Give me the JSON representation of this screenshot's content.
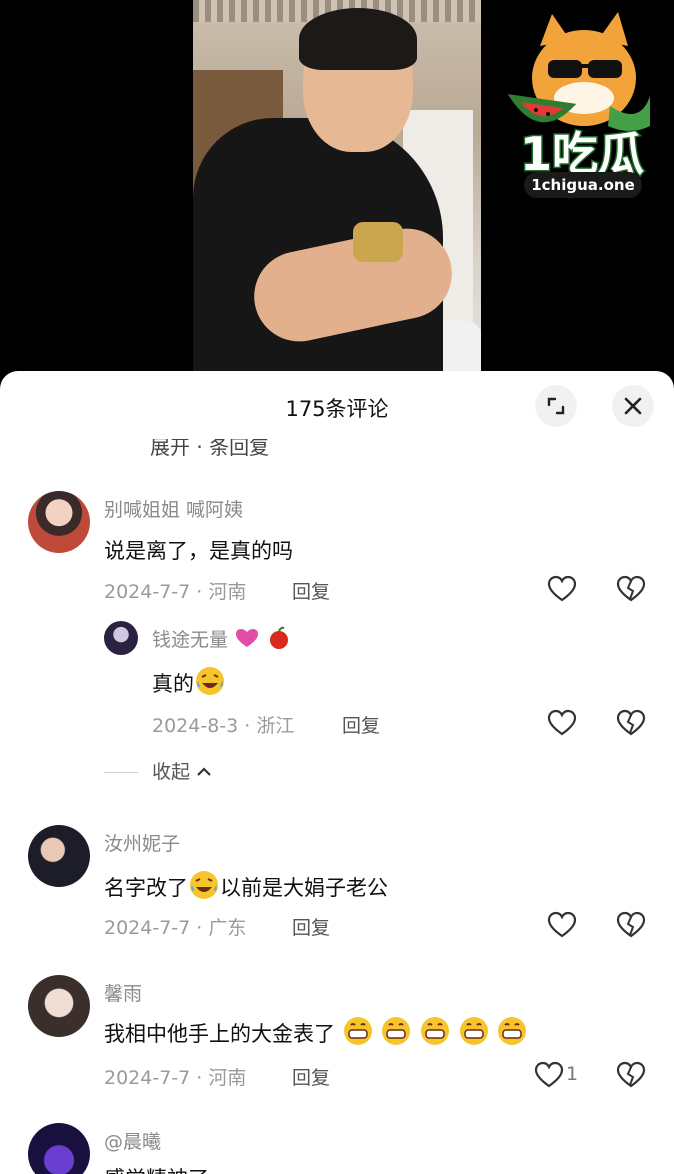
{
  "logo": {
    "text": "1吃瓜",
    "url": "1chigua.one"
  },
  "sheet": {
    "title": "175条评论",
    "prev_text": "展开 · 条回复",
    "expand_icon": "expand-icon",
    "close_icon": "close-icon"
  },
  "comments": [
    {
      "user": "别喊姐姐 喊阿姨",
      "text": "说是离了，是真的吗",
      "date": "2024-7-7 · 河南",
      "reply": "回复"
    },
    {
      "user": "钱途无量",
      "text": "真的",
      "date": "2024-8-3 · 浙江",
      "reply": "回复",
      "is_reply": true
    },
    {
      "user": "汝州妮子",
      "text_before": "名字改了",
      "text_after": "以前是大娟子老公",
      "date": "2024-7-7 · 广东",
      "reply": "回复"
    },
    {
      "user": "馨雨",
      "text": "我相中他手上的大金表了",
      "date": "2024-7-7 · 河南",
      "reply": "回复",
      "likes": "1"
    },
    {
      "user": "@晨曦",
      "text": "感觉精神了"
    }
  ],
  "collapse_label": "收起",
  "colors": {
    "accent_green": "#1f6b2a",
    "text_dark": "#111111",
    "text_gray": "#9a9a9a"
  }
}
